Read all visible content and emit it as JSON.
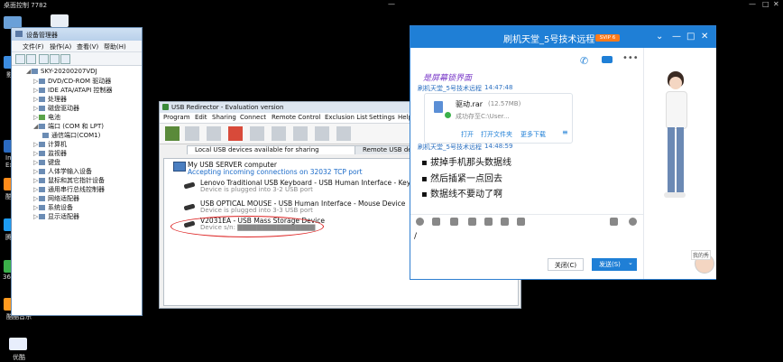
{
  "remote": {
    "title": "桌面控制 7782",
    "min": "—",
    "max": "□",
    "close": "✕"
  },
  "desktop": {
    "labels": [
      "影",
      "Intr",
      "Exp",
      "酷",
      "腾",
      "360",
      "酷酷音乐",
      "优酷"
    ]
  },
  "devmgr": {
    "title": "设备管理器",
    "menu": [
      "文件(F)",
      "操作(A)",
      "查看(V)",
      "帮助(H)"
    ],
    "root": "SKY-20200207VDJ",
    "items": [
      "DVD/CD-ROM 驱动器",
      "IDE ATA/ATAPI 控制器",
      "处理器",
      "磁盘驱动器",
      "电池",
      "端口 (COM 和 LPT)",
      "通信端口(COM1)",
      "计算机",
      "监视器",
      "键盘",
      "人体学输入设备",
      "鼠标和其它指针设备",
      "通用串行总线控制器",
      "网络适配器",
      "系统设备",
      "显示适配器"
    ]
  },
  "usb": {
    "title": "USB Redirector - Evaluation version",
    "menu": [
      "Program",
      "Edit",
      "Sharing",
      "Connect",
      "Remote Control",
      "Exclusion List",
      "Settings",
      "Help"
    ],
    "tab_local": "Local USB devices available for sharing",
    "tab_remote": "Remote USB devic",
    "server_name": "My USB SERVER computer",
    "server_status": "Accepting incoming connections on 32032 TCP port",
    "devices": [
      {
        "name": "Lenovo Traditional USB Keyboard - USB Human Interface - Keyboard Devi",
        "status": "Device is plugged into 3-2 USB port"
      },
      {
        "name": "USB OPTICAL MOUSE - USB Human Interface - Mouse Device",
        "status": "Device is plugged into 3-3 USB port"
      },
      {
        "name": "V2031EA - USB Mass Storage Device",
        "status": "Device s/n: ▇▇▇▇▇▇▇▇▇▇▇▇▇▇▇▇"
      }
    ]
  },
  "chat": {
    "title": "刷机天堂_5号技术远程",
    "badge": "SVIP 6",
    "italic_msg": "是屏幕锁界面",
    "sender1": "刷机天堂_5号技术远程",
    "time1": "14:47:48",
    "file_name": "驱动.rar",
    "file_size": "(12.57MB)",
    "file_status": "成功存至C:\\User...",
    "file_actions": [
      "打开",
      "打开文件夹",
      "更多下载"
    ],
    "sender2": "刷机天堂_5号技术远程",
    "time2": "14:48:59",
    "lines": [
      "拔掉手机那头数据线",
      "然后插紧一点回去",
      "数据线不要动了啊"
    ],
    "input_value": "/",
    "close_btn": "关闭(C)",
    "send_btn": "发送(S)",
    "send_caret": "⌄",
    "avatar_label": "我的秀"
  }
}
